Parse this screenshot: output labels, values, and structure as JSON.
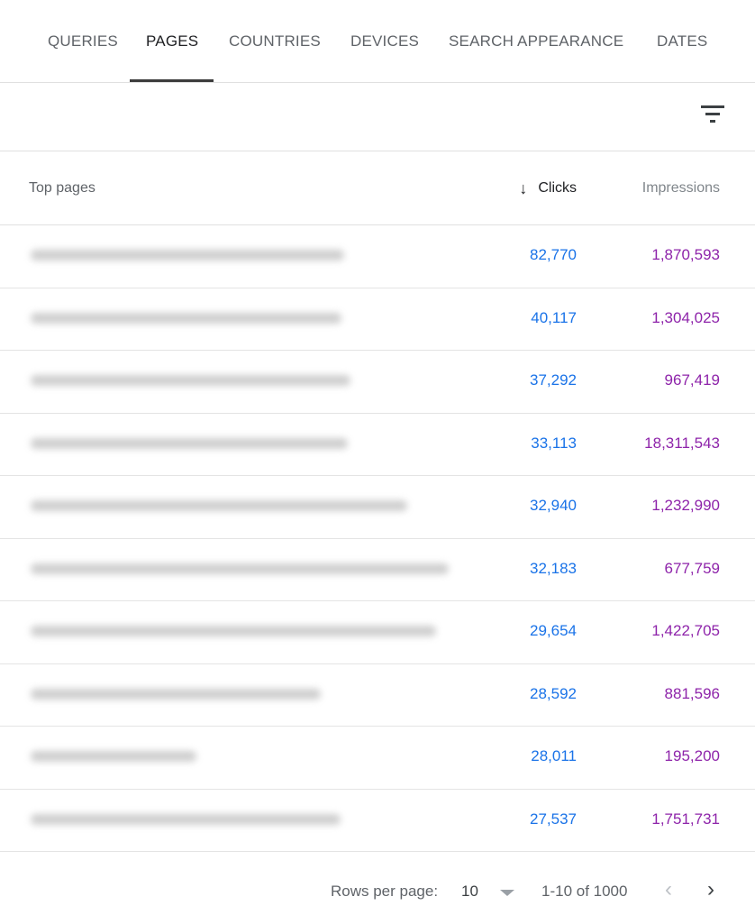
{
  "tabs": [
    {
      "label": "QUERIES",
      "active": false
    },
    {
      "label": "PAGES",
      "active": true
    },
    {
      "label": "COUNTRIES",
      "active": false
    },
    {
      "label": "DEVICES",
      "active": false
    },
    {
      "label": "SEARCH APPEARANCE",
      "active": false
    },
    {
      "label": "DATES",
      "active": false
    }
  ],
  "toolbar": {
    "filter_icon": "filter-list-icon"
  },
  "table": {
    "headers": {
      "pages": "Top pages",
      "sort_icon": "arrow-down-icon",
      "sort_arrow": "↓",
      "clicks": "Clicks",
      "impressions": "Impressions"
    },
    "rows": [
      {
        "url": "[blurred]",
        "clicks": "82,770",
        "impressions": "1,870,593"
      },
      {
        "url": "[blurred]",
        "clicks": "40,117",
        "impressions": "1,304,025"
      },
      {
        "url": "[blurred]",
        "clicks": "37,292",
        "impressions": "967,419"
      },
      {
        "url": "[blurred]",
        "clicks": "33,113",
        "impressions": "18,311,543"
      },
      {
        "url": "[blurred]",
        "clicks": "32,940",
        "impressions": "1,232,990"
      },
      {
        "url": "[blurred]",
        "clicks": "32,183",
        "impressions": "677,759"
      },
      {
        "url": "[blurred]",
        "clicks": "29,654",
        "impressions": "1,422,705"
      },
      {
        "url": "[blurred]",
        "clicks": "28,592",
        "impressions": "881,596"
      },
      {
        "url": "[blurred]",
        "clicks": "28,011",
        "impressions": "195,200"
      },
      {
        "url": "[blurred]",
        "clicks": "27,537",
        "impressions": "1,751,731"
      }
    ]
  },
  "colors": {
    "clicks": "#1a73e8",
    "impressions": "#8e24aa",
    "tab_active_indicator": "#3c3c3c"
  },
  "pagination": {
    "rows_per_page_label": "Rows per page:",
    "rows_per_page_value": "10",
    "range_text": "1-10 of 1000",
    "prev_glyph": "‹",
    "next_glyph": "›"
  }
}
